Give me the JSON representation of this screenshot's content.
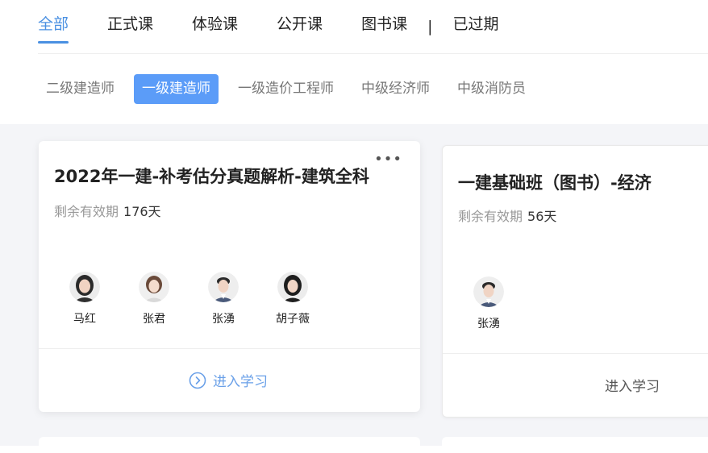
{
  "tabs": [
    {
      "label": "全部"
    },
    {
      "label": "正式课"
    },
    {
      "label": "体验课"
    },
    {
      "label": "公开课"
    },
    {
      "label": "图书课"
    },
    {
      "label": "已过期"
    }
  ],
  "tab_separator": "|",
  "subtabs": [
    {
      "label": "二级建造师"
    },
    {
      "label": "一级建造师"
    },
    {
      "label": "一级造价工程师"
    },
    {
      "label": "中级经济师"
    },
    {
      "label": "中级消防员"
    }
  ],
  "colors": {
    "accent": "#4a90e2",
    "subtab_active": "#5b9cf8",
    "background": "#f4f5f8"
  },
  "courses": [
    {
      "title": "2022年一建-补考估分真题解析-建筑全科",
      "validity_label": "剩余有效期",
      "validity_value": "176天",
      "teachers": [
        {
          "name": "马红"
        },
        {
          "name": "张君"
        },
        {
          "name": "张湧"
        },
        {
          "name": "胡子薇"
        }
      ],
      "enter_label": "进入学习",
      "more_icon": "more-horizontal-icon"
    },
    {
      "title": "一建基础班（图书）-经济",
      "validity_label": "剩余有效期",
      "validity_value": "56天",
      "teachers": [
        {
          "name": "张湧"
        }
      ],
      "enter_label": "进入学习"
    }
  ]
}
